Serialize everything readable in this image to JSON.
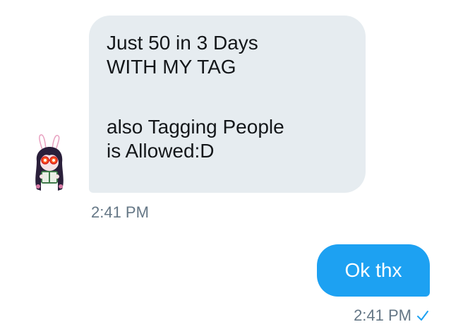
{
  "incoming": {
    "lines": [
      "Just 50 in 3 Days",
      "WITH MY TAG",
      "also Tagging People",
      "is Allowed:D"
    ],
    "time": "2:41 PM"
  },
  "outgoing": {
    "text": "Ok thx",
    "time": "2:41 PM",
    "status_icon": "read-check-icon"
  },
  "colors": {
    "incoming_bubble": "#e6ecf0",
    "outgoing_bubble": "#1da1f2",
    "timestamp": "#657786",
    "check": "#1da1f2"
  }
}
